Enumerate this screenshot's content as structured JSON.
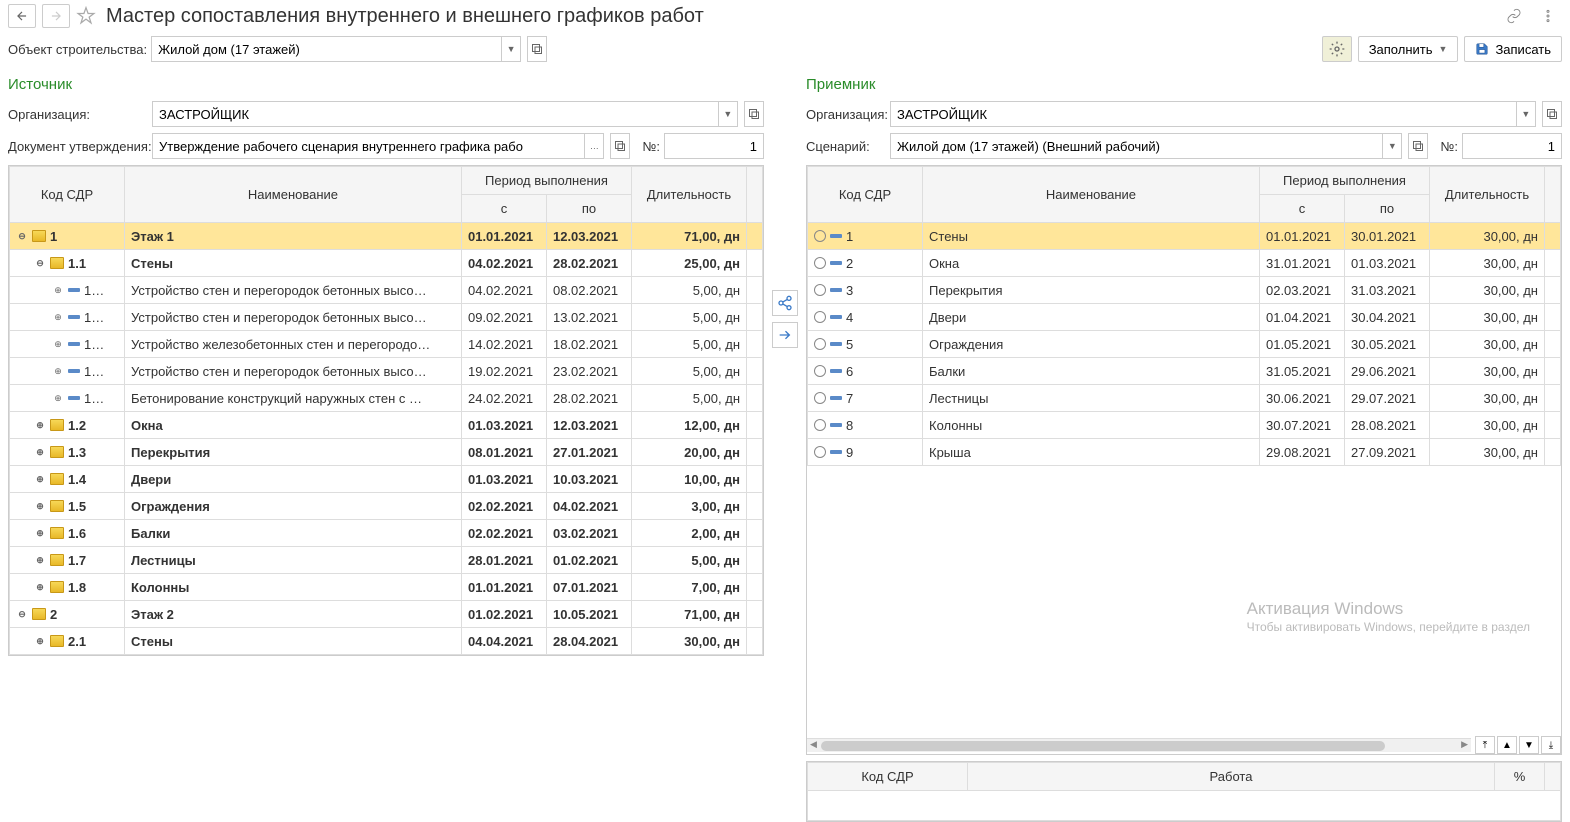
{
  "header": {
    "title": "Мастер сопоставления внутреннего и внешнего графиков работ"
  },
  "construction": {
    "label": "Объект строительства:",
    "value": "Жилой дом (17 этажей)"
  },
  "actions": {
    "fill": "Заполнить",
    "save": "Записать"
  },
  "source": {
    "title": "Источник",
    "org_label": "Организация:",
    "org_value": "ЗАСТРОЙЩИК",
    "doc_label": "Документ утверждения:",
    "doc_value": "Утверждение рабочего сценария внутреннего графика рабо",
    "num_label": "№:",
    "num_value": "1",
    "cols": {
      "code": "Код СДР",
      "name": "Наименование",
      "period": "Период выполнения",
      "from": "с",
      "to": "по",
      "dur": "Длительность"
    },
    "rows": [
      {
        "lvl": 0,
        "exp": "⊖",
        "ic": "fo",
        "code": "1",
        "name": "Этаж 1",
        "f": "01.01.2021",
        "t": "12.03.2021",
        "d": "71,00, дн",
        "sel": true,
        "bold": true
      },
      {
        "lvl": 1,
        "exp": "⊖",
        "ic": "f",
        "code": "1.1",
        "name": "Стены",
        "f": "04.02.2021",
        "t": "28.02.2021",
        "d": "25,00, дн",
        "bold": true
      },
      {
        "lvl": 2,
        "exp": "⊕",
        "ic": "i",
        "code": "1…",
        "name": "Устройство стен и перегородок бетонных высо…",
        "f": "04.02.2021",
        "t": "08.02.2021",
        "d": "5,00, дн"
      },
      {
        "lvl": 2,
        "exp": "⊕",
        "ic": "i",
        "code": "1…",
        "name": "Устройство стен и перегородок бетонных высо…",
        "f": "09.02.2021",
        "t": "13.02.2021",
        "d": "5,00, дн"
      },
      {
        "lvl": 2,
        "exp": "⊕",
        "ic": "i",
        "code": "1…",
        "name": "Устройство железобетонных стен и перегородо…",
        "f": "14.02.2021",
        "t": "18.02.2021",
        "d": "5,00, дн"
      },
      {
        "lvl": 2,
        "exp": "⊕",
        "ic": "i",
        "code": "1…",
        "name": "Устройство стен и перегородок бетонных высо…",
        "f": "19.02.2021",
        "t": "23.02.2021",
        "d": "5,00, дн"
      },
      {
        "lvl": 2,
        "exp": "⊕",
        "ic": "i",
        "code": "1…",
        "name": "Бетонирование конструкций наружных стен с …",
        "f": "24.02.2021",
        "t": "28.02.2021",
        "d": "5,00, дн"
      },
      {
        "lvl": 1,
        "exp": "⊕",
        "ic": "f",
        "code": "1.2",
        "name": "Окна",
        "f": "01.03.2021",
        "t": "12.03.2021",
        "d": "12,00, дн",
        "bold": true
      },
      {
        "lvl": 1,
        "exp": "⊕",
        "ic": "f",
        "code": "1.3",
        "name": "Перекрытия",
        "f": "08.01.2021",
        "t": "27.01.2021",
        "d": "20,00, дн",
        "bold": true
      },
      {
        "lvl": 1,
        "exp": "⊕",
        "ic": "f",
        "code": "1.4",
        "name": "Двери",
        "f": "01.03.2021",
        "t": "10.03.2021",
        "d": "10,00, дн",
        "bold": true
      },
      {
        "lvl": 1,
        "exp": "⊕",
        "ic": "f",
        "code": "1.5",
        "name": "Ограждения",
        "f": "02.02.2021",
        "t": "04.02.2021",
        "d": "3,00, дн",
        "bold": true
      },
      {
        "lvl": 1,
        "exp": "⊕",
        "ic": "f",
        "code": "1.6",
        "name": "Балки",
        "f": "02.02.2021",
        "t": "03.02.2021",
        "d": "2,00, дн",
        "bold": true
      },
      {
        "lvl": 1,
        "exp": "⊕",
        "ic": "f",
        "code": "1.7",
        "name": "Лестницы",
        "f": "28.01.2021",
        "t": "01.02.2021",
        "d": "5,00, дн",
        "bold": true
      },
      {
        "lvl": 1,
        "exp": "⊕",
        "ic": "f",
        "code": "1.8",
        "name": "Колонны",
        "f": "01.01.2021",
        "t": "07.01.2021",
        "d": "7,00, дн",
        "bold": true
      },
      {
        "lvl": 0,
        "exp": "⊖",
        "ic": "f",
        "code": "2",
        "name": "Этаж 2",
        "f": "01.02.2021",
        "t": "10.05.2021",
        "d": "71,00, дн",
        "bold": true
      },
      {
        "lvl": 1,
        "exp": "⊕",
        "ic": "f",
        "code": "2.1",
        "name": "Стены",
        "f": "04.04.2021",
        "t": "28.04.2021",
        "d": "30,00, дн",
        "bold": true
      }
    ]
  },
  "target": {
    "title": "Приемник",
    "org_label": "Организация:",
    "org_value": "ЗАСТРОЙЩИК",
    "scen_label": "Сценарий:",
    "scen_value": "Жилой дом (17 этажей) (Внешний рабочий)",
    "num_label": "№:",
    "num_value": "1",
    "cols": {
      "code": "Код СДР",
      "name": "Наименование",
      "period": "Период выполнения",
      "from": "с",
      "to": "по",
      "dur": "Длительность"
    },
    "rows": [
      {
        "code": "1",
        "name": "Стены",
        "f": "01.01.2021",
        "t": "30.01.2021",
        "d": "30,00, дн",
        "sel": true
      },
      {
        "code": "2",
        "name": "Окна",
        "f": "31.01.2021",
        "t": "01.03.2021",
        "d": "30,00, дн"
      },
      {
        "code": "3",
        "name": "Перекрытия",
        "f": "02.03.2021",
        "t": "31.03.2021",
        "d": "30,00, дн"
      },
      {
        "code": "4",
        "name": "Двери",
        "f": "01.04.2021",
        "t": "30.04.2021",
        "d": "30,00, дн"
      },
      {
        "code": "5",
        "name": "Ограждения",
        "f": "01.05.2021",
        "t": "30.05.2021",
        "d": "30,00, дн"
      },
      {
        "code": "6",
        "name": "Балки",
        "f": "31.05.2021",
        "t": "29.06.2021",
        "d": "30,00, дн"
      },
      {
        "code": "7",
        "name": "Лестницы",
        "f": "30.06.2021",
        "t": "29.07.2021",
        "d": "30,00, дн"
      },
      {
        "code": "8",
        "name": "Колонны",
        "f": "30.07.2021",
        "t": "28.08.2021",
        "d": "30,00, дн"
      },
      {
        "code": "9",
        "name": "Крыша",
        "f": "29.08.2021",
        "t": "27.09.2021",
        "d": "30,00, дн"
      }
    ],
    "bottom_cols": {
      "code": "Код СДР",
      "work": "Работа",
      "pct": "%"
    }
  },
  "watermark": {
    "l1": "Активация Windows",
    "l2": "Чтобы активировать Windows, перейдите в раздел"
  }
}
